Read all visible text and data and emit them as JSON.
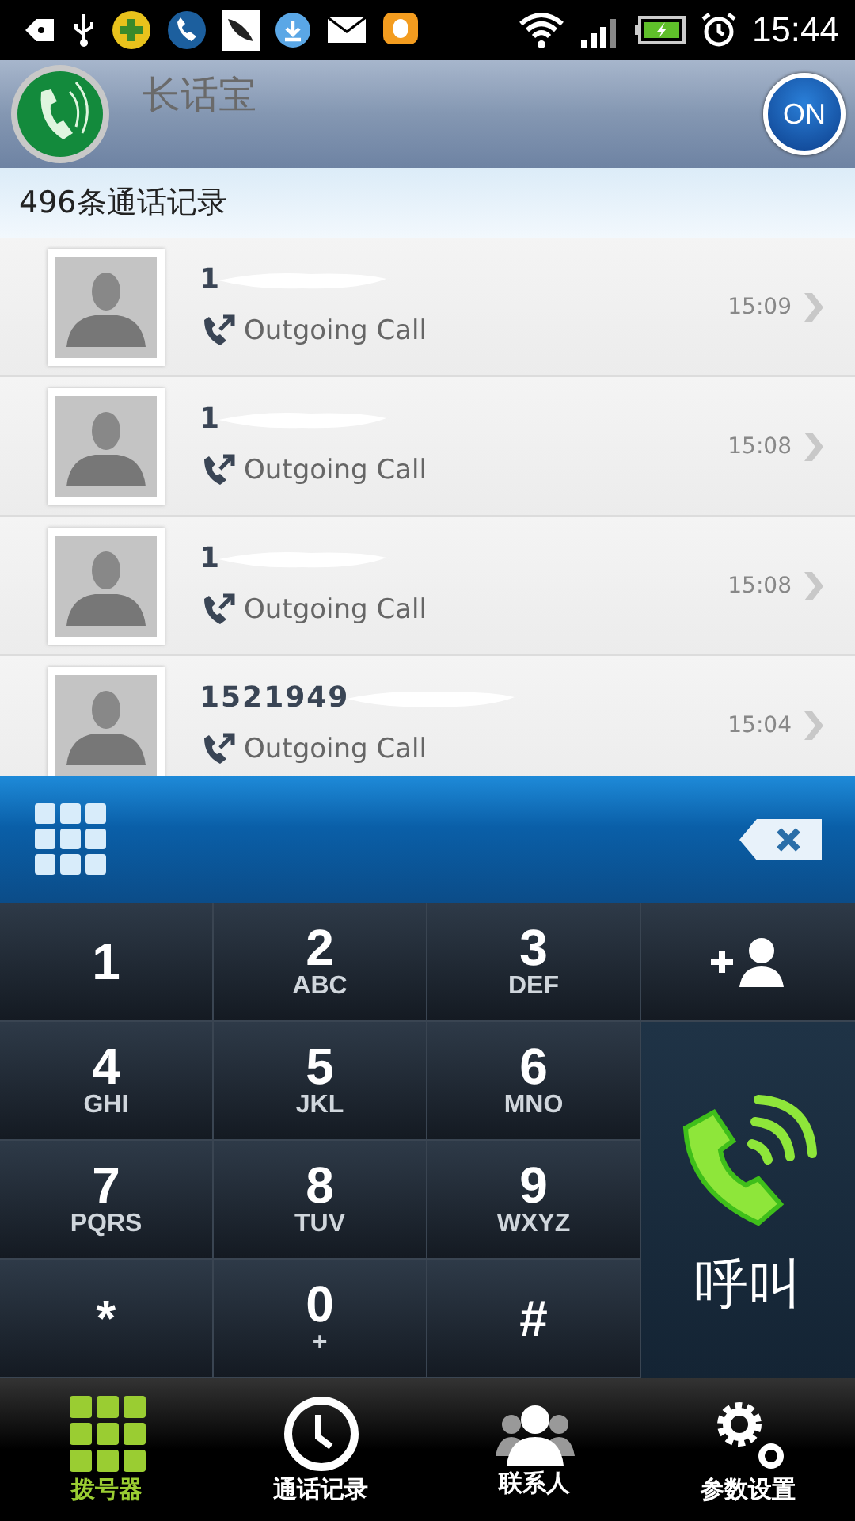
{
  "status_bar": {
    "time": "15:44"
  },
  "app_bar": {
    "title": "长话宝",
    "toggle": {
      "label": "ON",
      "on": true
    }
  },
  "record_count": "496条通话记录",
  "calls": [
    {
      "number": "1",
      "type": "Outgoing Call",
      "time": "15:09"
    },
    {
      "number": "1",
      "type": "Outgoing Call",
      "time": "15:08"
    },
    {
      "number": "1",
      "type": "Outgoing Call",
      "time": "15:08"
    },
    {
      "number": "1521949",
      "type": "Outgoing Call",
      "time": "15:04"
    }
  ],
  "keypad": [
    {
      "digit": "1"
    },
    {
      "digit": "2",
      "letters": "ABC"
    },
    {
      "digit": "3",
      "letters": "DEF"
    },
    {
      "digit": "4",
      "letters": "GHI"
    },
    {
      "digit": "5",
      "letters": "JKL"
    },
    {
      "digit": "6",
      "letters": "MNO"
    },
    {
      "digit": "7",
      "letters": "PQRS"
    },
    {
      "digit": "8",
      "letters": "TUV"
    },
    {
      "digit": "9",
      "letters": "WXYZ"
    },
    {
      "digit": "*"
    },
    {
      "digit": "0",
      "letters": "+"
    },
    {
      "digit": "#"
    }
  ],
  "call_button": {
    "label": "呼叫"
  },
  "nav": [
    {
      "label": "拨号器",
      "selected": true,
      "kind": "keypad"
    },
    {
      "label": "通话记录",
      "selected": false,
      "kind": "clock"
    },
    {
      "label": "联系人",
      "selected": false,
      "kind": "people"
    },
    {
      "label": "参数设置",
      "selected": false,
      "kind": "gear"
    }
  ]
}
